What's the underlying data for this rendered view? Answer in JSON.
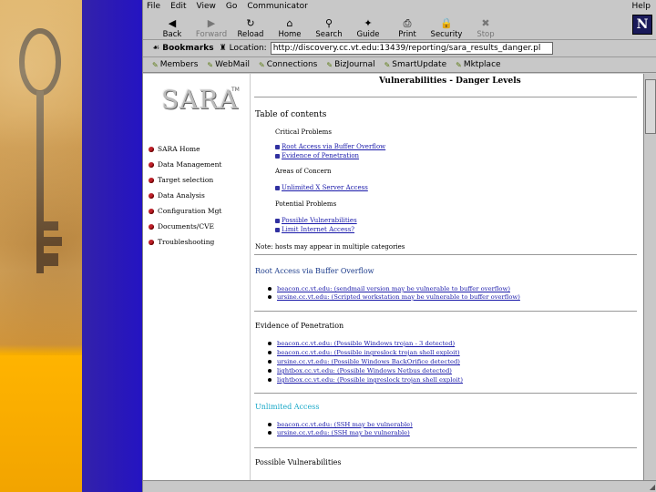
{
  "menu": [
    "File",
    "Edit",
    "View",
    "Go",
    "Communicator"
  ],
  "menu_help": "Help",
  "toolbar": [
    {
      "label": "Back",
      "icon": "◀",
      "enabled": true,
      "name": "back-button",
      "icon_name": "back-arrow-icon"
    },
    {
      "label": "Forward",
      "icon": "▶",
      "enabled": false,
      "name": "forward-button",
      "icon_name": "forward-arrow-icon"
    },
    {
      "label": "Reload",
      "icon": "↻",
      "enabled": true,
      "name": "reload-button",
      "icon_name": "reload-icon"
    },
    {
      "label": "Home",
      "icon": "⌂",
      "enabled": true,
      "name": "home-button",
      "icon_name": "home-icon"
    },
    {
      "label": "Search",
      "icon": "⚲",
      "enabled": true,
      "name": "search-button",
      "icon_name": "search-icon"
    },
    {
      "label": "Guide",
      "icon": "✦",
      "enabled": true,
      "name": "guide-button",
      "icon_name": "guide-icon"
    },
    {
      "label": "Print",
      "icon": "⎙",
      "enabled": true,
      "name": "print-button",
      "icon_name": "print-icon"
    },
    {
      "label": "Security",
      "icon": "🔒",
      "enabled": true,
      "name": "security-button",
      "icon_name": "lock-icon"
    },
    {
      "label": "Stop",
      "icon": "✖",
      "enabled": false,
      "name": "stop-button",
      "icon_name": "stop-icon"
    }
  ],
  "location": {
    "bookmarks_label": "Bookmarks",
    "location_label": "Location:",
    "url": "http://discovery.cc.vt.edu:13439/reporting/sara_results_danger.pl"
  },
  "personal": [
    "Members",
    "WebMail",
    "Connections",
    "BizJournal",
    "SmartUpdate",
    "Mktplace"
  ],
  "side": {
    "logo": "SARA",
    "tm": "TM",
    "nav": [
      "SARA Home",
      "Data Management",
      "Target selection",
      "Data Analysis",
      "Configuration Mgt",
      "Documents/CVE",
      "Troubleshooting"
    ]
  },
  "main": {
    "title": "Vulnerabilities - Danger Levels",
    "toc_title": "Table of contents",
    "toc_critical": "Critical Problems",
    "toc_critical_items": [
      "Root Access via Buffer Overflow",
      "Evidence of Penetration"
    ],
    "toc_concern": "Areas of Concern",
    "toc_concern_items": [
      "Unlimited X Server Access"
    ],
    "toc_potential": "Potential Problems",
    "toc_potential_items": [
      "Possible Vulnerabilities",
      "Limit Internet Access?"
    ],
    "note": "Note: hosts may appear in multiple categories",
    "sections": [
      {
        "heading": "Root Access via Buffer Overflow",
        "items": [
          "beacon.cc.vt.edu: (sendmail version may be vulnerable to buffer overflow)",
          "ursine.cc.vt.edu: (Scripted workstation may be vulnerable to buffer overflow)"
        ]
      },
      {
        "heading": "Evidence of Penetration",
        "items": [
          "beacon.cc.vt.edu: (Possible Windows trojan - 3 detected)",
          "beacon.cc.vt.edu: (Possible ingreslock trojan shell exploit)",
          "ursine.cc.vt.edu: (Possible Windows BackOrifice detected)",
          "lightbox.cc.vt.edu: (Possible Windows Netbus detected)",
          "lightbox.cc.vt.edu: (Possible ingreslock trojan shell exploit)"
        ]
      },
      {
        "heading": "Unlimited Access",
        "items": [
          "beacon.cc.vt.edu: (SSH may be vulnerable)",
          "ursine.cc.vt.edu: (SSH may be vulnerable)"
        ]
      },
      {
        "heading": "Possible Vulnerabilities",
        "items": []
      }
    ]
  },
  "colors": {
    "purple_bar": "#2a18b8",
    "link": "#1a1aaa",
    "nav_dot": "#c0202a",
    "unlimited_heading": "#18a8c8"
  }
}
